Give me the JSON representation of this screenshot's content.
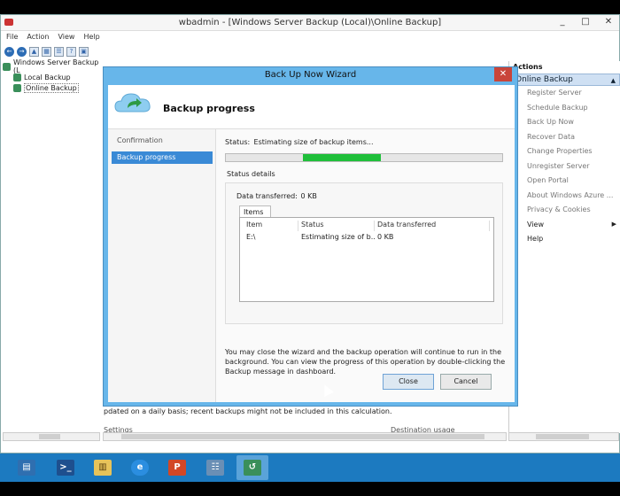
{
  "window": {
    "title": "wbadmin - [Windows Server Backup (Local)\\Online Backup]",
    "controls": [
      "_",
      "□",
      "✕"
    ]
  },
  "menubar": [
    "File",
    "Action",
    "View",
    "Help"
  ],
  "tree": {
    "root": "Windows Server Backup (L",
    "children": [
      "Local Backup",
      "Online Backup"
    ]
  },
  "actions": {
    "header": "Actions",
    "section": "Online Backup",
    "items": [
      "Register Server",
      "Schedule Backup",
      "Back Up Now",
      "Recover Data",
      "Change Properties",
      "Unregister Server",
      "Open Portal",
      "About Windows Azure ...",
      "Privacy & Cookies",
      "View",
      "Help"
    ]
  },
  "content": {
    "info_line": "pdated on a daily basis; recent backups might not be included in this calculation.",
    "col_settings": "Settings",
    "col_destination_usage": "Destination usage"
  },
  "wizard": {
    "title": "Back Up Now Wizard",
    "close_glyph": "✕",
    "heading": "Backup progress",
    "steps": [
      "Confirmation",
      "Backup progress"
    ],
    "status_label": "Status:",
    "status_value": "Estimating size of backup items...",
    "status_details_label": "Status details",
    "data_transferred_label": "Data transferred:",
    "data_transferred_value": "0 KB",
    "items_tab": "Items",
    "columns": [
      "Item",
      "Status",
      "Data transferred"
    ],
    "rows": [
      {
        "item": "E:\\",
        "status": "Estimating size of b...",
        "data": "0 KB"
      }
    ],
    "note": "You may close the wizard and the backup operation will continue to run in the background. You can view the progress of this operation by double-clicking the Backup message in dashboard.",
    "close_button": "Close",
    "cancel_button": "Cancel"
  },
  "taskbar": {
    "apps": [
      "server-manager-icon",
      "powershell-icon",
      "file-explorer-icon",
      "internet-explorer-icon",
      "powerpoint-icon",
      "control-panel-icon",
      "windows-backup-icon"
    ],
    "glyphs": [
      "▤",
      ">_",
      "▥",
      "e",
      "P",
      "☷",
      "↺"
    ]
  }
}
